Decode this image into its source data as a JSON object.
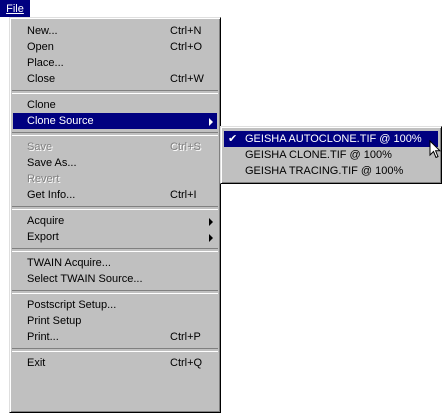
{
  "menubar": {
    "file": "File"
  },
  "file_menu": {
    "new": "New...",
    "new_sc": "Ctrl+N",
    "open": "Open",
    "open_sc": "Ctrl+O",
    "place": "Place...",
    "close": "Close",
    "close_sc": "Ctrl+W",
    "clone": "Clone",
    "clone_source": "Clone Source",
    "save": "Save",
    "save_sc": "Ctrl+S",
    "save_as": "Save As...",
    "revert": "Revert",
    "get_info": "Get Info...",
    "get_info_sc": "Ctrl+I",
    "acquire": "Acquire",
    "export": "Export",
    "twain_acquire": "TWAIN Acquire...",
    "select_twain_source": "Select TWAIN Source...",
    "postscript_setup": "Postscript Setup...",
    "print_setup": "Print Setup",
    "print": "Print...",
    "print_sc": "Ctrl+P",
    "exit": "Exit",
    "exit_sc": "Ctrl+Q"
  },
  "clone_submenu": {
    "items": [
      {
        "label": "GEISHA AUTOCLONE.TIF @ 100%",
        "checked": true
      },
      {
        "label": "GEISHA CLONE.TIF @ 100%",
        "checked": false
      },
      {
        "label": "GEISHA TRACING.TIF @ 100%",
        "checked": false
      }
    ],
    "check_glyph": "✔"
  },
  "colors": {
    "highlight": "#000080",
    "menu_bg": "#c0c0c0",
    "disabled": "#808080"
  }
}
